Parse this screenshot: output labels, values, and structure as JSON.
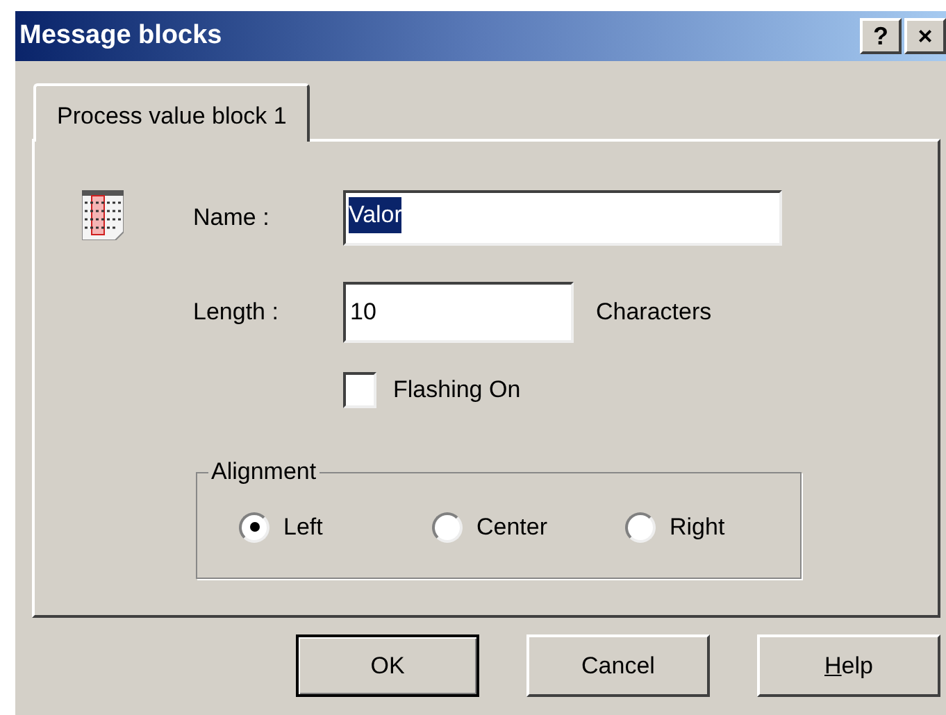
{
  "window": {
    "title": "Message blocks",
    "title_buttons": [
      "?",
      "×"
    ]
  },
  "tabs": [
    {
      "label": "Process value block 1",
      "selected": true
    }
  ],
  "name_field": {
    "label": "Name :",
    "value": "Valor",
    "selected": true
  },
  "length_field": {
    "label": "Length :",
    "value": "10",
    "unit": "Characters"
  },
  "flashing": {
    "label": "Flashing On",
    "checked": false
  },
  "alignment": {
    "title": "Alignment",
    "options": [
      {
        "label": "Left",
        "selected": true
      },
      {
        "label": "Center",
        "selected": false
      },
      {
        "label": "Right",
        "selected": false
      }
    ]
  },
  "buttons": [
    {
      "label": "OK",
      "default": true
    },
    {
      "label": "Cancel",
      "default": false
    },
    {
      "label_parts": [
        {
          "text": "H",
          "underlined": true
        },
        {
          "text": "elp",
          "underlined": false
        }
      ],
      "default": false
    }
  ]
}
